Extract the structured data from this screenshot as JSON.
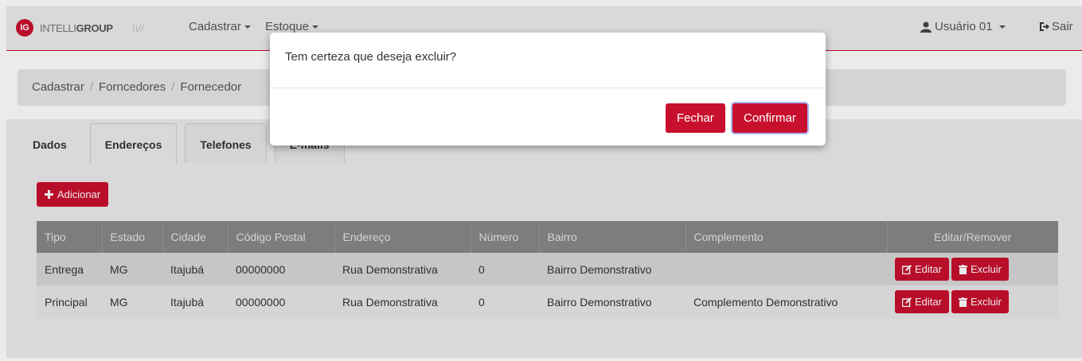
{
  "navbar": {
    "brand_mark": "IG",
    "brand_text_light": "INTELLI",
    "brand_text_bold": "GROUP",
    "brand_slash": "\\\\//",
    "menus": [
      "Cadastrar",
      "Estoque"
    ],
    "user": "Usuário 01",
    "logout": "Sair"
  },
  "breadcrumb": [
    "Cadastrar",
    "Forncedores",
    "Fornecedor"
  ],
  "tabs": [
    {
      "label": "Dados"
    },
    {
      "label": "Endereços"
    },
    {
      "label": "Telefones"
    },
    {
      "label": "E-mails"
    }
  ],
  "add_button": "Adicionar",
  "table": {
    "headers": [
      "Tipo",
      "Estado",
      "Cidade",
      "Código Postal",
      "Endereço",
      "Número",
      "Bairro",
      "Complemento",
      "Editar/Remover"
    ],
    "rows": [
      {
        "tipo": "Entrega",
        "estado": "MG",
        "cidade": "Itajubá",
        "cep": "00000000",
        "endereco": "Rua Demonstrativa",
        "numero": "0",
        "bairro": "Bairro Demonstrativo",
        "complemento": ""
      },
      {
        "tipo": "Principal",
        "estado": "MG",
        "cidade": "Itajubá",
        "cep": "00000000",
        "endereco": "Rua Demonstrativa",
        "numero": "0",
        "bairro": "Bairro Demonstrativo",
        "complemento": "Complemento Demonstrativo"
      }
    ],
    "edit_label": "Editar",
    "delete_label": "Excluir"
  },
  "modal": {
    "message": "Tem certeza que deseja excluir?",
    "close_label": "Fechar",
    "confirm_label": "Confirmar"
  },
  "colors": {
    "accent": "#c8102e",
    "header_bg": "#888888"
  }
}
